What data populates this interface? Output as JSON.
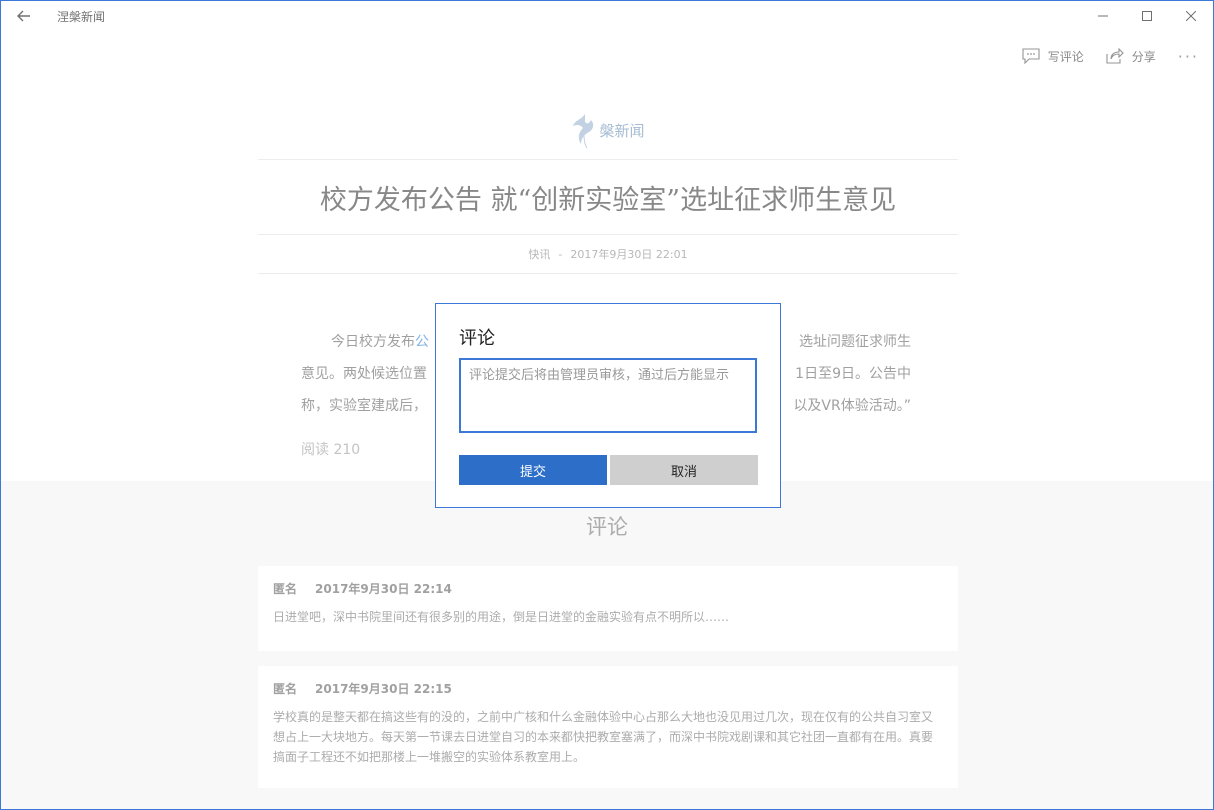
{
  "app": {
    "title": "涅槃新闻"
  },
  "cmdbar": {
    "write_comment": "写评论",
    "share": "分享",
    "more": "···"
  },
  "article": {
    "logo_text": "槃新闻",
    "headline": "校方发布公告 就“创新实验室”选址征求师生意见",
    "category": "快讯",
    "separator": "-",
    "datetime": "2017年9月30日 22:01",
    "para1_start": "今日校方发布",
    "para1_link": "公",
    "para1_right": "选址问题征求师生",
    "para2_left": "意见。两处候选位置",
    "para2_right": "1日至9日。公告中",
    "para3_left": "称，实验室建成后，",
    "para3_right": "以及VR体验活动。”",
    "reads": "阅读 210"
  },
  "comments": {
    "section_title": "评论",
    "items": [
      {
        "author": "匿名",
        "date": "2017年9月30日 22:14",
        "text": "日进堂吧，深中书院里间还有很多别的用途，倒是日进堂的金融实验有点不明所以……"
      },
      {
        "author": "匿名",
        "date": "2017年9月30日 22:15",
        "text": "学校真的是整天都在搞这些有的没的，之前中广核和什么金融体验中心占那么大地也没见用过几次，现在仅有的公共自习室又想占上一大块地方。每天第一节课去日进堂自习的本来都快把教室塞满了，而深中书院戏剧课和其它社团一直都有在用。真要搞面子工程还不如把那楼上一堆搬空的实验体系教室用上。"
      }
    ]
  },
  "dialog": {
    "title": "评论",
    "placeholder": "评论提交后将由管理员审核，通过后方能显示",
    "value": "",
    "submit": "提交",
    "cancel": "取消"
  },
  "colors": {
    "accent": "#3b78d8",
    "submit_bg": "#2d6ec9",
    "cancel_bg": "#cfcfcf",
    "link": "#4a90d9"
  }
}
